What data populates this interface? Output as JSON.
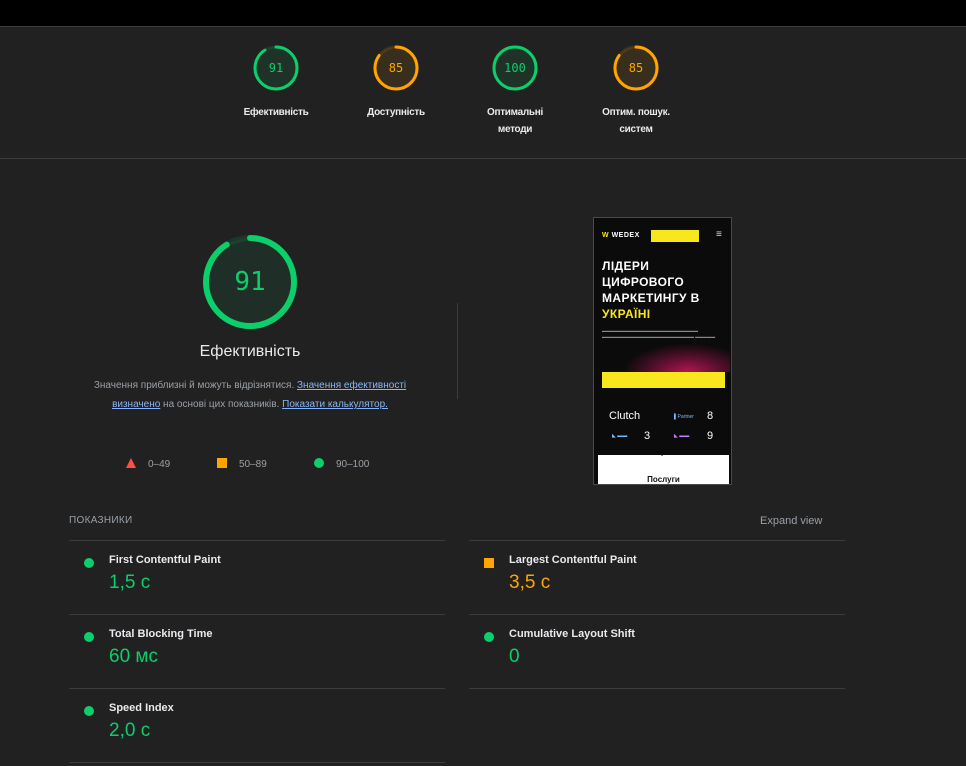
{
  "colors": {
    "pass": "#0cce6b",
    "average": "#ffa400",
    "fail": "#ff4e42",
    "background": "#212121"
  },
  "summary": [
    {
      "score": "91",
      "label": "Ефективність",
      "color": "#0cce6b",
      "fraction": 0.91
    },
    {
      "score": "85",
      "label": "Доступність",
      "color": "#ffa400",
      "fraction": 0.85
    },
    {
      "score": "100",
      "label": "Оптимальні методи",
      "color": "#0cce6b",
      "fraction": 1.0
    },
    {
      "score": "85",
      "label": "Оптим. пошук. систем",
      "color": "#ffa400",
      "fraction": 0.85
    }
  ],
  "performance": {
    "score": "91",
    "fraction": 0.91,
    "title": "Ефективність",
    "desc_1": "Значення приблизні й можуть відрізнятися. ",
    "desc_link_1": "Значення ефективності визначено",
    "desc_2": " на основі цих показників. ",
    "desc_link_2": "Показати калькулятор."
  },
  "legend": [
    {
      "range": "0–49",
      "shape": "triangle"
    },
    {
      "range": "50–89",
      "shape": "square"
    },
    {
      "range": "90–100",
      "shape": "circle"
    }
  ],
  "screenshot": {
    "logo_text": "WEDEX",
    "headline_lines": [
      "ЛІДЕРИ",
      "ЦИФРОВОГО",
      "МАРКЕТИНГУ В"
    ],
    "headline_accent": "УКРАЇНІ",
    "clutch": "Clutch",
    "rank_1": "8",
    "rank_2": "3",
    "rank_3": "9",
    "services": "Послуги",
    "menu_icon": "hamburger-icon"
  },
  "metrics_section": {
    "title": "ПОКАЗНИКИ",
    "expand_label": "Expand view"
  },
  "metrics": [
    {
      "name": "First Contentful Paint",
      "value": "1,5 с",
      "status": "pass"
    },
    {
      "name": "Largest Contentful Paint",
      "value": "3,5 с",
      "status": "average"
    },
    {
      "name": "Total Blocking Time",
      "value": "60 мс",
      "status": "pass"
    },
    {
      "name": "Cumulative Layout Shift",
      "value": "0",
      "status": "pass"
    },
    {
      "name": "Speed Index",
      "value": "2,0 с",
      "status": "pass"
    }
  ]
}
